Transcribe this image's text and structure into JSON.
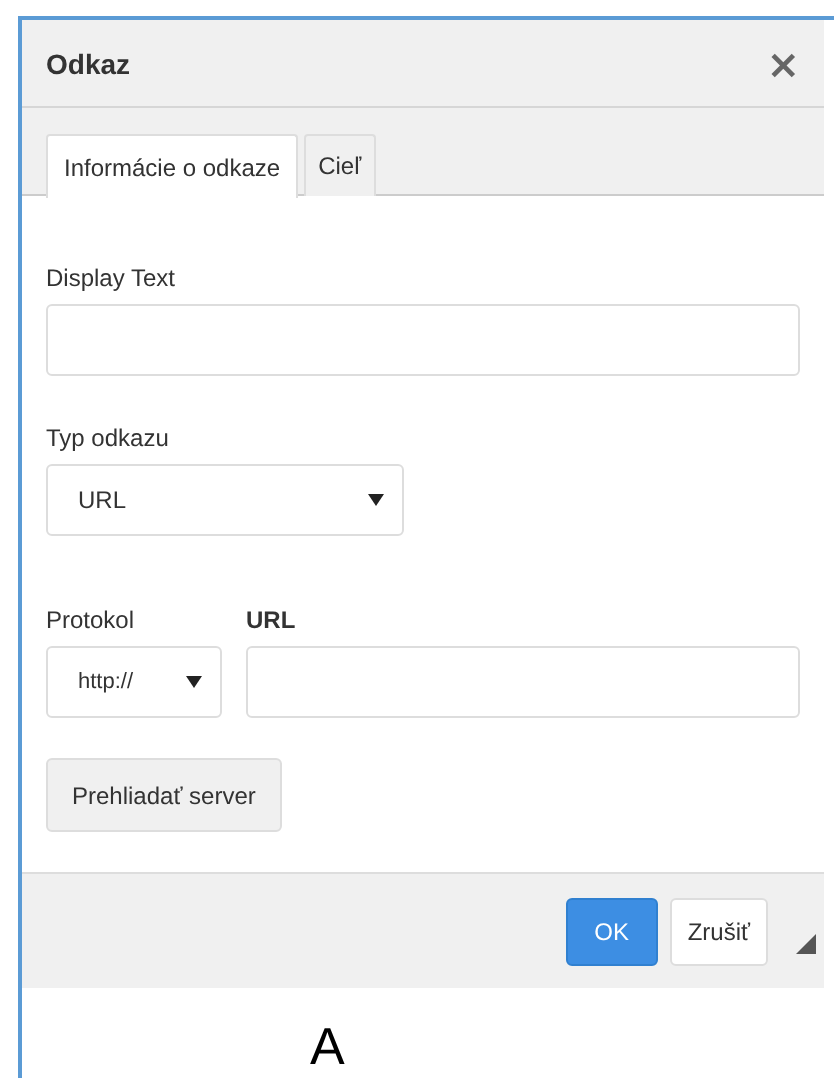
{
  "dialog": {
    "title": "Odkaz",
    "close": "×"
  },
  "tabs": [
    {
      "label": "Informácie o odkaze",
      "selected": true
    },
    {
      "label": "Cieľ",
      "selected": false
    }
  ],
  "fields": [
    {
      "kind": "text",
      "label": "Display Text"
    },
    {
      "kind": "select",
      "label": "Typ odkazu",
      "value": "URL"
    }
  ],
  "url_row": {
    "protocol_label": "Protokol",
    "protocol_value": "http://",
    "url_label": "URL"
  },
  "browse_button": "Prehliadať server",
  "buttons": [
    {
      "label": "OK",
      "kind": "primary"
    },
    {
      "label": "Zrušiť",
      "kind": "secondary"
    }
  ],
  "below_text": "A"
}
